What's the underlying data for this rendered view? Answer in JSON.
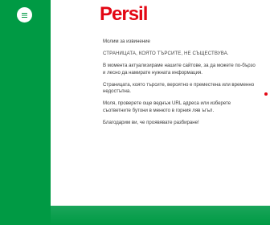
{
  "brand": {
    "logo_text": "Persil",
    "accent_color": "#e30613",
    "sidebar_color": "#009a44"
  },
  "menu": {
    "icon": "hamburger-menu-icon"
  },
  "message": {
    "apology": "Молим за извинение",
    "heading": "СТРАНИЦАТА, КОЯТО ТЪРСИТЕ, НЕ СЪЩЕСТВУВА.",
    "update_notice": "В момента актуализираме нашите сайтове, за да можете по-бързо и лесно да намирате нужната информация.",
    "moved_notice": "Страницата, която търсите, вероятно е преместена или временно недостъпна.",
    "check_prefix": "Моля, проверете още веднъж URL адреса или изберете съответните бутони в менюто в горния ляв ъгъл.",
    "thanks": "Благодарим ви, че проявявате разбиране!"
  }
}
